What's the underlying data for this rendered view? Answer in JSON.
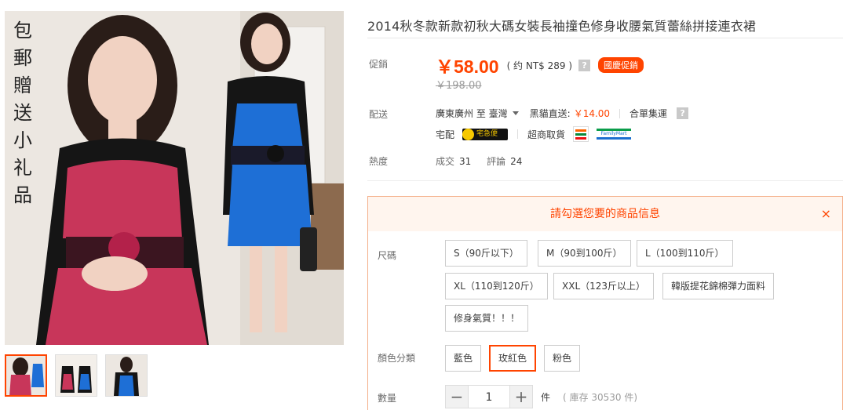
{
  "product": {
    "title": "2014秋冬款新款初秋大碼女裝長袖撞色修身收腰氣質蕾絲拼接連衣裙",
    "promo_text_lines": [
      "包",
      "郵",
      "贈",
      "送",
      "小",
      "礼",
      "品"
    ]
  },
  "gallery": {
    "thumbs": [
      "thumb-1",
      "thumb-2",
      "thumb-3"
    ],
    "active_index": 0
  },
  "price": {
    "label": "促銷",
    "current": "￥58.00",
    "approx": "( 约 NT$ 289 )",
    "help_icon": "?",
    "badge": "國慶促銷",
    "original": "￥198.00"
  },
  "shipping": {
    "label": "配送",
    "from_to": "廣東廣州 至  臺灣",
    "direct_label": "黑貓直送:",
    "direct_price": "￥14.00",
    "consolidated": "合單集運",
    "help_icon": "?",
    "home_label": "宅配",
    "cat_logo_text": "宅急便",
    "store_label": "超商取貨",
    "familymart_text": "FamilyMart"
  },
  "heat": {
    "label": "熱度",
    "sales_label": "成交",
    "sales": "31",
    "reviews_label": "評論",
    "reviews": "24"
  },
  "options": {
    "header": "請勾選您要的商品信息",
    "close_icon": "×",
    "size_label": "尺碼",
    "sizes": [
      "S（90斤以下）",
      "M（90到100斤）",
      "L（100到110斤）",
      "XL（110到120斤）",
      "XXL（123斤以上）",
      "韓版提花錦棉彈力面料",
      "修身氣質！！！"
    ],
    "color_label": "顏色分類",
    "colors": [
      "藍色",
      "玫紅色",
      "粉色"
    ],
    "selected_color": "玫紅色",
    "qty_label": "數量",
    "qty_minus": "−",
    "qty_value": "1",
    "qty_plus": "+",
    "qty_unit": "件",
    "stock": "( 庫存 30530 件)"
  },
  "colors": {
    "accent": "#ff4400",
    "blue_dress": "#1e6fd6",
    "rose_dress": "#c8365a"
  }
}
